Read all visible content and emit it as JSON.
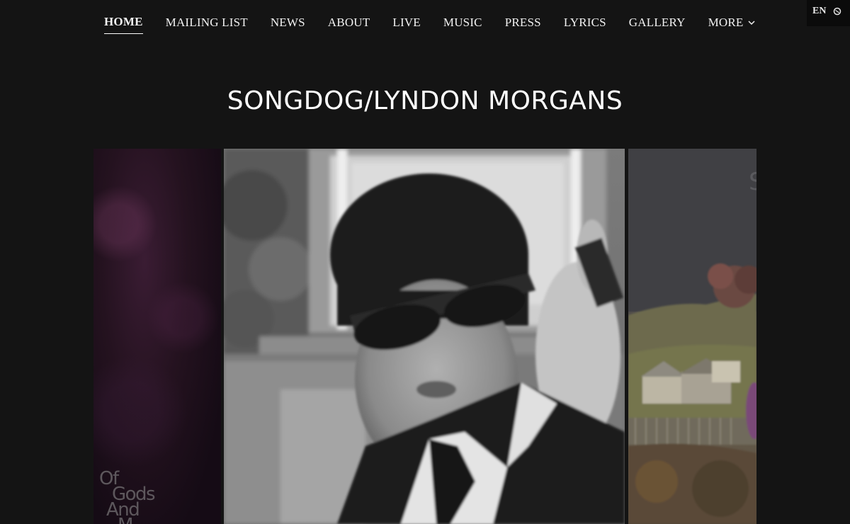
{
  "nav": {
    "items": [
      {
        "label": "HOME",
        "active": true
      },
      {
        "label": "MAILING LIST",
        "active": false
      },
      {
        "label": "NEWS",
        "active": false
      },
      {
        "label": "ABOUT",
        "active": false
      },
      {
        "label": "LIVE",
        "active": false
      },
      {
        "label": "MUSIC",
        "active": false
      },
      {
        "label": "PRESS",
        "active": false
      },
      {
        "label": "LYRICS",
        "active": false
      },
      {
        "label": "GALLERY",
        "active": false
      }
    ],
    "more_label": "MORE",
    "more_icon": "chevron-down-icon"
  },
  "language": {
    "code": "EN",
    "icon": "globe-icon"
  },
  "page": {
    "title": "SONGDOG/LYNDON MORGANS"
  },
  "gallery": {
    "left_cover_text": [
      "Of",
      "Gods",
      "And",
      "M"
    ],
    "right_cover_text": "S"
  },
  "colors": {
    "background": "#141414",
    "text": "#ffffff"
  }
}
